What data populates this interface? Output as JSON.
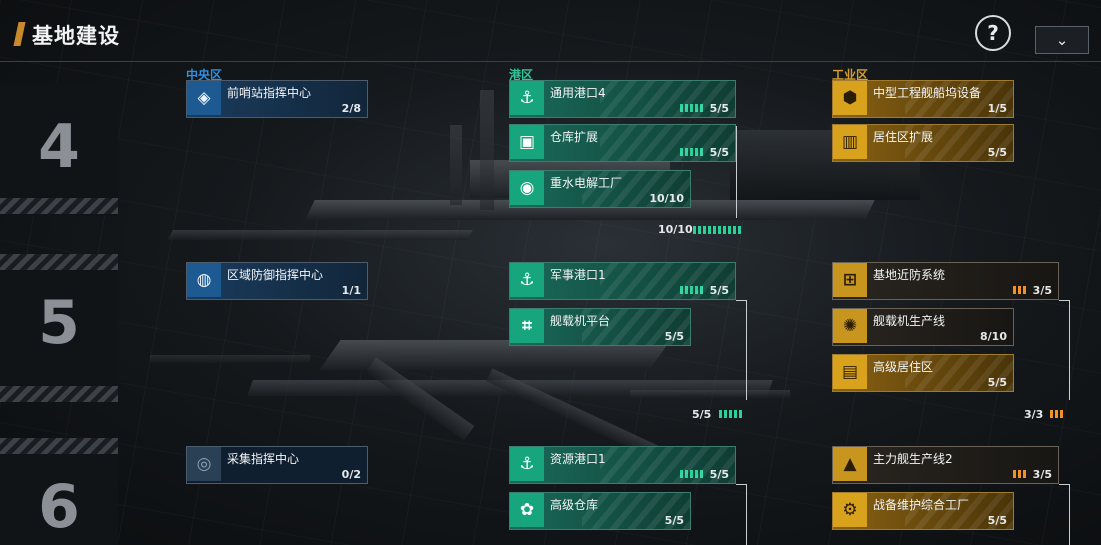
{
  "header": {
    "title": "基地建设",
    "help_label": "?",
    "collapse_label": "⌄"
  },
  "columns": {
    "central": "中央区",
    "harbor": "港区",
    "industry": "工业区"
  },
  "levels": [
    "4",
    "5",
    "6"
  ],
  "cards": {
    "c1": {
      "label": "前哨站指挥中心",
      "count": "2/8",
      "icon": "outpost-command-icon"
    },
    "c2": {
      "label": "区域防御指挥中心",
      "count": "1/1",
      "icon": "defense-command-icon"
    },
    "c3": {
      "label": "采集指挥中心",
      "count": "0/2",
      "icon": "collection-command-icon"
    },
    "h1": {
      "label": "通用港口4",
      "count": "5/5",
      "icon": "anchor-icon",
      "icon_text": "⚓"
    },
    "h2": {
      "label": "仓库扩展",
      "count": "5/5",
      "icon": "warehouse-expand-icon",
      "icon_text": "▣"
    },
    "h3": {
      "label": "重水电解工厂",
      "count": "10/10",
      "icon": "electrolysis-icon",
      "icon_text": "◉"
    },
    "h4": {
      "label": "军事港口1",
      "count": "5/5",
      "icon": "military-anchor-icon",
      "icon_text": "⚓"
    },
    "h5": {
      "label": "舰载机平台",
      "count": "5/5",
      "icon": "carrier-platform-icon",
      "icon_text": "⌗"
    },
    "h6": {
      "label": "资源港口1",
      "count": "5/5",
      "icon": "resource-anchor-icon",
      "icon_text": "⚓"
    },
    "h7": {
      "label": "高级仓库",
      "count": "5/5",
      "icon": "advanced-warehouse-icon",
      "icon_text": "✿"
    },
    "i1": {
      "label": "中型工程舰船坞设备",
      "count": "1/5",
      "icon": "dock-equipment-icon",
      "icon_text": "⬢"
    },
    "i2": {
      "label": "居住区扩展",
      "count": "5/5",
      "icon": "residential-icon",
      "icon_text": "▥"
    },
    "i3": {
      "label": "基地近防系统",
      "count": "3/5",
      "icon": "close-defense-icon",
      "icon_text": "⊞"
    },
    "i4": {
      "label": "舰载机生产线",
      "count": "8/10",
      "icon": "aircraft-line-icon",
      "icon_text": "✺"
    },
    "i5": {
      "label": "高级居住区",
      "count": "5/5",
      "icon": "advanced-residential-icon",
      "icon_text": "▤"
    },
    "i6": {
      "label": "主力舰生产线2",
      "count": "3/5",
      "icon": "capital-ship-line-icon",
      "icon_text": "▲"
    },
    "i7": {
      "label": "战备维护综合工厂",
      "count": "5/5",
      "icon": "maintenance-factory-icon",
      "icon_text": "⚙"
    }
  },
  "group_totals": {
    "harbor_l4": "10/10",
    "harbor_l5": "5/5",
    "industry_l5": "3/3"
  },
  "colors": {
    "central_text": "#2f8fe0",
    "harbor_text": "#2fc79a",
    "industry_text": "#d8a02a"
  }
}
